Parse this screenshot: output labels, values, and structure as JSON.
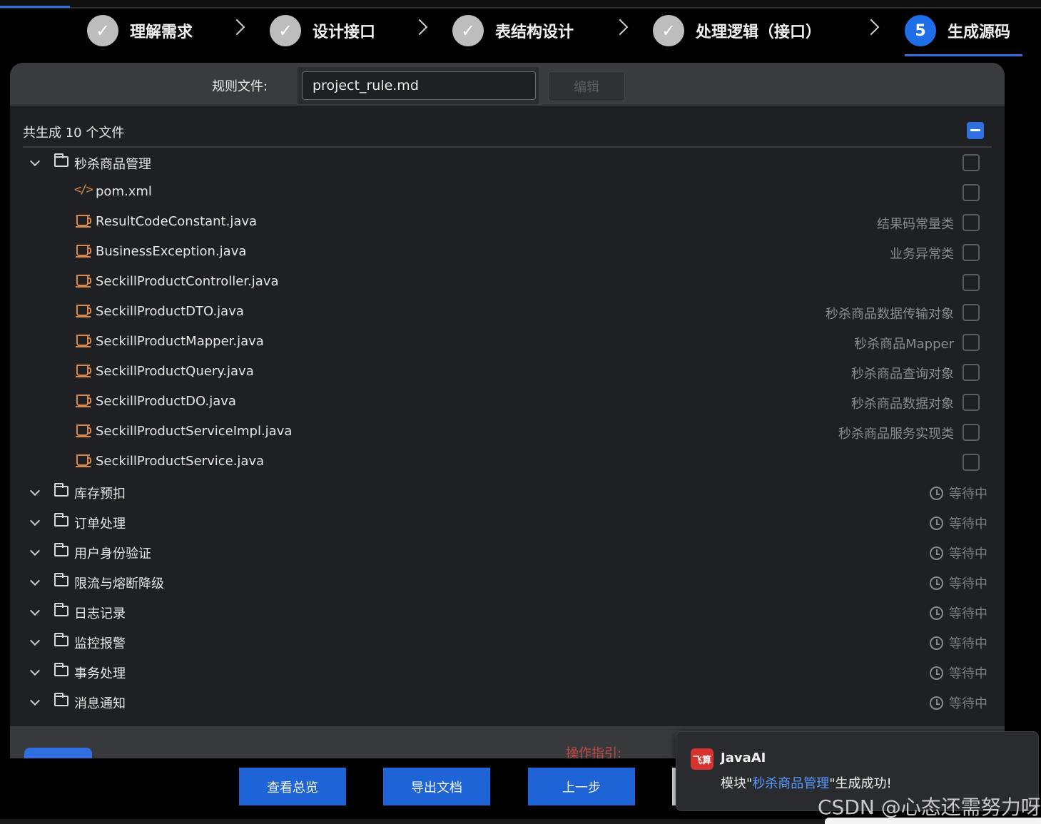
{
  "stepper": {
    "steps": [
      {
        "label": "理解需求",
        "mark": "✓"
      },
      {
        "label": "设计接口",
        "mark": "✓"
      },
      {
        "label": "表结构设计",
        "mark": "✓"
      },
      {
        "label": "处理逻辑（接口）",
        "mark": "✓"
      },
      {
        "label": "生成源码",
        "mark": "5"
      }
    ]
  },
  "rules": {
    "label": "规则文件:",
    "file_value": "project_rule.md",
    "edit_label": "编辑"
  },
  "tree": {
    "summary": "共生成 10 个文件",
    "module": {
      "name": "秒杀商品管理",
      "files": [
        {
          "name": "pom.xml",
          "desc": ""
        },
        {
          "name": "ResultCodeConstant.java",
          "desc": "结果码常量类"
        },
        {
          "name": "BusinessException.java",
          "desc": "业务异常类"
        },
        {
          "name": "SeckillProductController.java",
          "desc": ""
        },
        {
          "name": "SeckillProductDTO.java",
          "desc": "秒杀商品数据传输对象"
        },
        {
          "name": "SeckillProductMapper.java",
          "desc": "秒杀商品Mapper"
        },
        {
          "name": "SeckillProductQuery.java",
          "desc": "秒杀商品查询对象"
        },
        {
          "name": "SeckillProductDO.java",
          "desc": "秒杀商品数据对象"
        },
        {
          "name": "SeckillProductServiceImpl.java",
          "desc": "秒杀商品服务实现类"
        },
        {
          "name": "SeckillProductService.java",
          "desc": ""
        }
      ]
    },
    "pending_status": "等待中",
    "pending_modules": [
      "库存预扣",
      "订单处理",
      "用户身份验证",
      "限流与熔断降级",
      "日志记录",
      "监控报警",
      "事务处理",
      "消息通知"
    ]
  },
  "footer": {
    "guide": "操作指引:"
  },
  "buttons": {
    "overview": "查看总览",
    "export": "导出文档",
    "prev": "上一步"
  },
  "notification": {
    "logo": "飞算",
    "title": "JavaAI",
    "msg_prefix": "模块\"",
    "msg_module": "秒杀商品管理",
    "msg_suffix": "\"生成成功!"
  },
  "watermark": "CSDN @心态还需努力呀",
  "colors": {
    "accent": "#1e64d6",
    "file_icon": "#d9894a",
    "guide_text": "#c24a45"
  }
}
